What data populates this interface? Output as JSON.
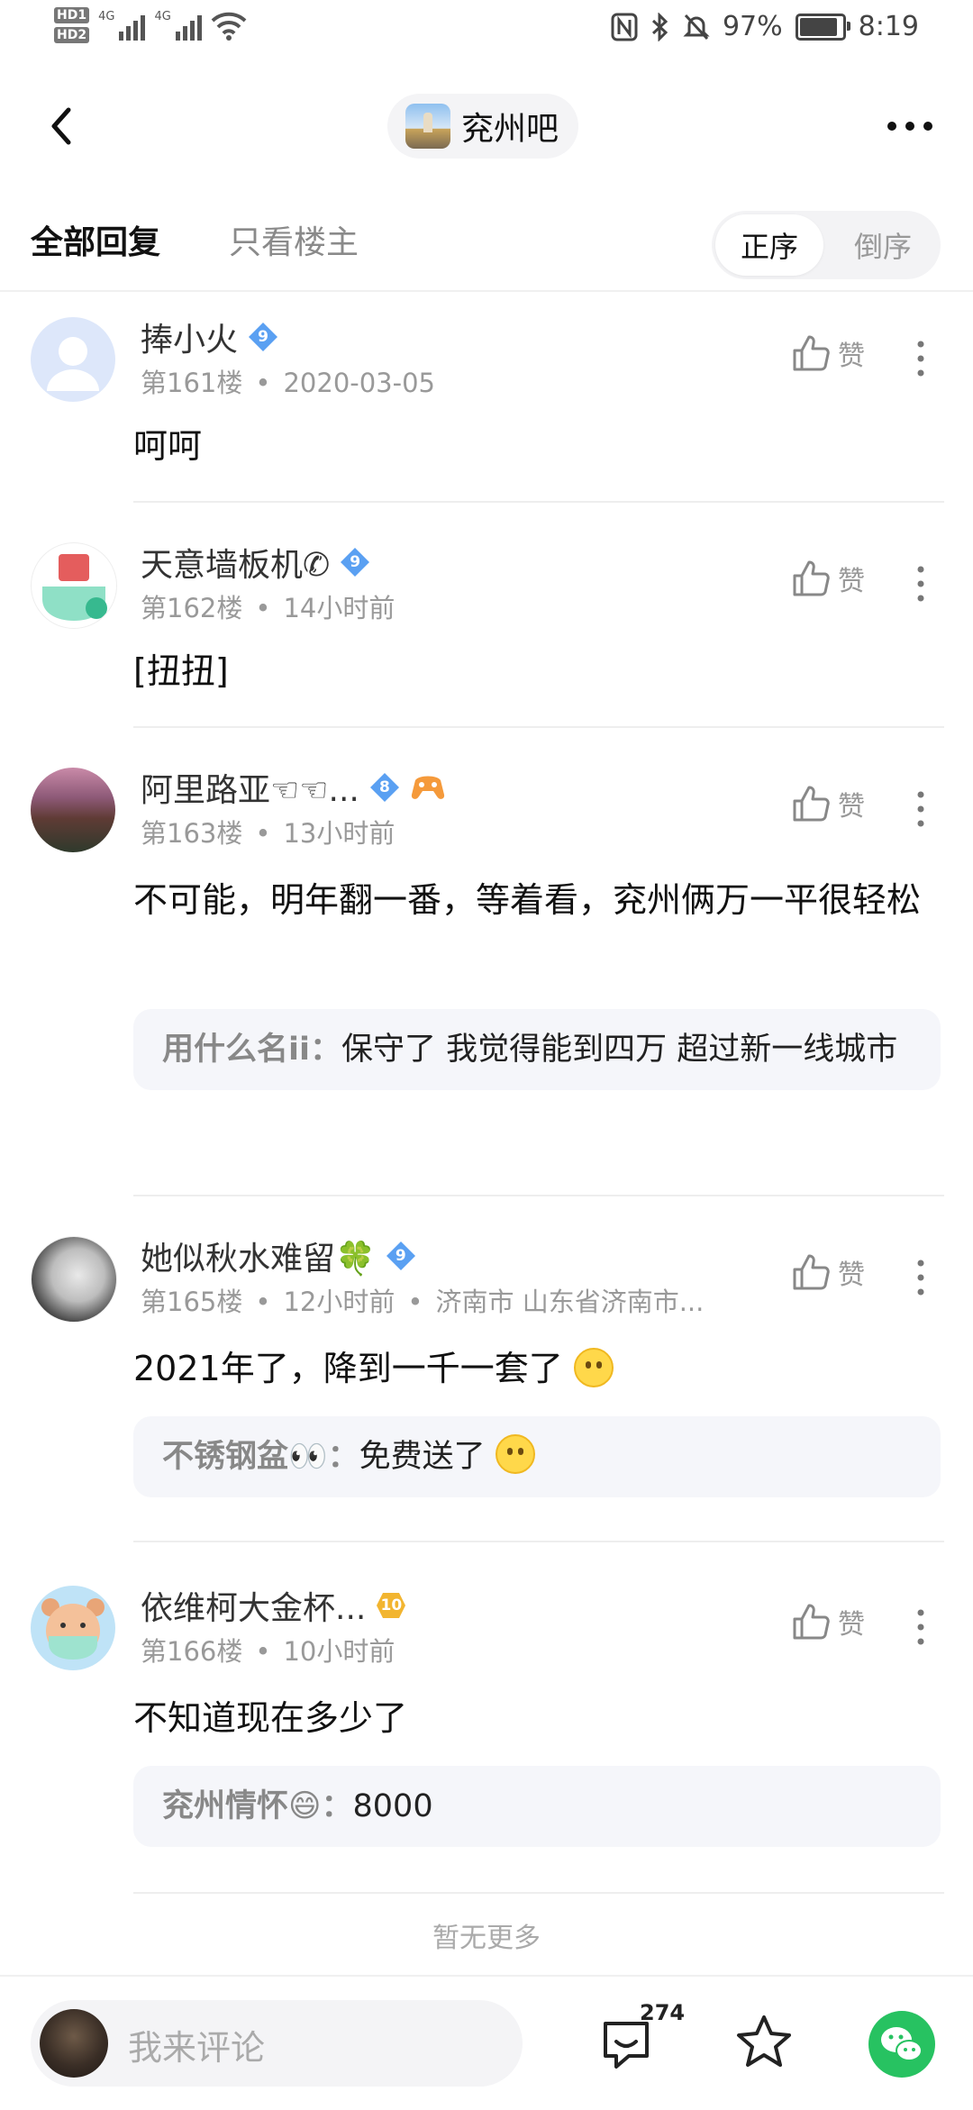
{
  "status_bar": {
    "hd1": "HD1",
    "hd2": "HD2",
    "network1": "4G",
    "network2": "4G",
    "battery": "97%",
    "battery_level": 0.97,
    "time": "8:19"
  },
  "header": {
    "forum_name": "兖州吧"
  },
  "tabs": {
    "all_replies": "全部回复",
    "only_op": "只看楼主",
    "order_asc": "正序",
    "order_desc": "倒序"
  },
  "posts": [
    {
      "username": "捧小火",
      "level": "9",
      "floor": "第161楼",
      "time": "2020-03-05",
      "location": "",
      "content": "呵呵",
      "like_label": "赞"
    },
    {
      "username": "天意墙板机✆",
      "level": "9",
      "floor": "第162楼",
      "time": "14小时前",
      "location": "",
      "content": "[扭扭]",
      "like_label": "赞"
    },
    {
      "username": "阿里路亚☜☜...",
      "level": "8",
      "floor": "第163楼",
      "time": "13小时前",
      "location": "",
      "content": "不可能，明年翻一番，等着看，兖州俩万一平很轻松",
      "like_label": "赞",
      "reply": {
        "user": "用什么名ii",
        "text": "保守了 我觉得能到四万 超过新一线城市"
      }
    },
    {
      "username": "她似秋水难留🍀",
      "level": "9",
      "floor": "第165楼",
      "time": "12小时前",
      "location": "济南市 山东省济南市...",
      "content": "2021年了，降到一千一套了",
      "like_label": "赞",
      "reply": {
        "user": "不锈钢盆👀",
        "text": "免费送了"
      }
    },
    {
      "username": "依维柯大金杯...",
      "level": "10",
      "floor": "第166楼",
      "time": "10小时前",
      "location": "",
      "content": "不知道现在多少了",
      "like_label": "赞",
      "reply": {
        "user": "兖州情怀😄",
        "text": "8000"
      }
    }
  ],
  "footer": {
    "no_more": "暂无更多",
    "comment_placeholder": "我来评论",
    "reply_count": "274"
  },
  "colors": {
    "level_badge": "#5aa0f2",
    "level_badge_gold": "#f2b530",
    "wechat": "#27c261",
    "reply_bg": "#f5f6fa"
  }
}
